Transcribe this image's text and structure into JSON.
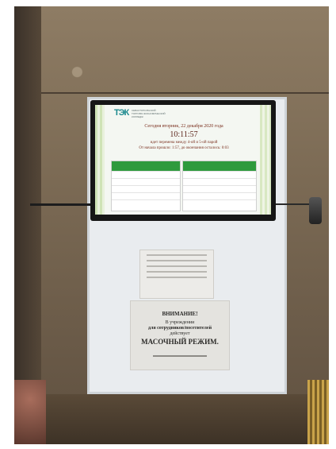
{
  "screen": {
    "logo": "ТЭК",
    "logo_sub": "СЕВАСТОПОЛЬСКИЙ ТОРГОВО-ЭКОНОМИЧЕСКИЙ КОЛЛЕДЖ",
    "line1": "Сегодня вторник, 22 декабря 2020 года",
    "time": "10:11:57",
    "line3": "идет перемена между 4-ой и 5-ой парой",
    "line4": "От начала прошло: 1:57, до окончания осталось: 0:03"
  },
  "notice": {
    "title": "ВНИМАНИЕ!",
    "line2": "В учреждении",
    "line3": "для сотрудников/посетителей",
    "line4": "действует",
    "line5": "МАСОЧНЫЙ РЕЖИМ."
  }
}
